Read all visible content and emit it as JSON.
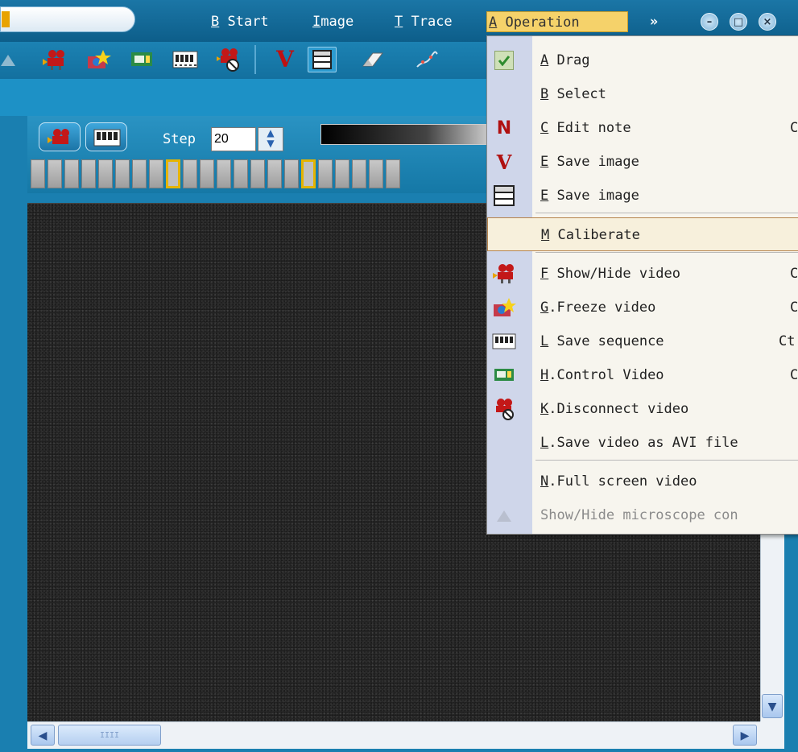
{
  "menubar": {
    "items": [
      {
        "key": "B",
        "label": " Start"
      },
      {
        "key": "I",
        "label": "mage"
      },
      {
        "key": "T",
        "label": " Trace"
      },
      {
        "key": "A",
        "label": " Operation"
      }
    ],
    "more": "»",
    "window_buttons": {
      "minimize": "–",
      "maximize": "□",
      "close": "×"
    }
  },
  "toolbar": {
    "icons": [
      "show-hide-video-icon",
      "freeze-video-icon",
      "control-video-icon",
      "save-sequence-icon",
      "disconnect-video-icon",
      "save-image-v-icon",
      "save-image-frame-icon",
      "eraser-icon",
      "trace-icon"
    ],
    "v_glyph": "V"
  },
  "video_panel": {
    "step_label": "Step",
    "step_value": "20",
    "frame_count": 22,
    "marked_frames": [
      8,
      16
    ]
  },
  "scrollbars": {
    "down": "▼",
    "left": "◀",
    "right": "▶",
    "thumb_grip": "IIII"
  },
  "operation_menu": {
    "items": [
      {
        "key": "A",
        "label": " Drag",
        "shortcut": "",
        "icon": "check-icon",
        "checked": true
      },
      {
        "key": "B",
        "label": " Select",
        "shortcut": "",
        "icon": ""
      },
      {
        "key": "C",
        "label": " Edit note",
        "shortcut": "C",
        "icon": "note-n-icon",
        "glyph": "N"
      },
      {
        "key": "E",
        "label": " Save image",
        "shortcut": "",
        "icon": "save-image-v-icon",
        "glyph": "V"
      },
      {
        "key": "E",
        "label": " Save image",
        "shortcut": "",
        "icon": "save-image-frame-icon"
      },
      {
        "key": "M",
        "label": " Caliberate",
        "shortcut": "",
        "icon": "",
        "highlighted": true
      },
      {
        "key": "F",
        "label": " Show/Hide video",
        "shortcut": "C",
        "icon": "show-hide-video-icon"
      },
      {
        "key": "G",
        "label": ".Freeze video",
        "shortcut": "C",
        "icon": "freeze-video-icon"
      },
      {
        "key": "L",
        "label": " Save sequence",
        "shortcut": "Ct",
        "icon": "save-sequence-icon"
      },
      {
        "key": "H",
        "label": ".Control Video",
        "shortcut": "C",
        "icon": "control-video-icon"
      },
      {
        "key": "K",
        "label": ".Disconnect video",
        "shortcut": "",
        "icon": "disconnect-video-icon"
      },
      {
        "key": "L",
        "label": ".Save video as AVI file",
        "shortcut": "",
        "icon": ""
      },
      {
        "key": "N",
        "label": ".Full screen video",
        "shortcut": "",
        "icon": ""
      },
      {
        "key": "",
        "label": "Show/Hide microscope con",
        "shortcut": "",
        "icon": "microscope-icon",
        "disabled": true
      }
    ]
  },
  "colors": {
    "title_bar": "#0d5e8a",
    "toolbar": "#1c82b3",
    "menu_highlight": "#f5d26a",
    "menu_gutter": "#cfd6ea",
    "video_bg": "#242424"
  }
}
